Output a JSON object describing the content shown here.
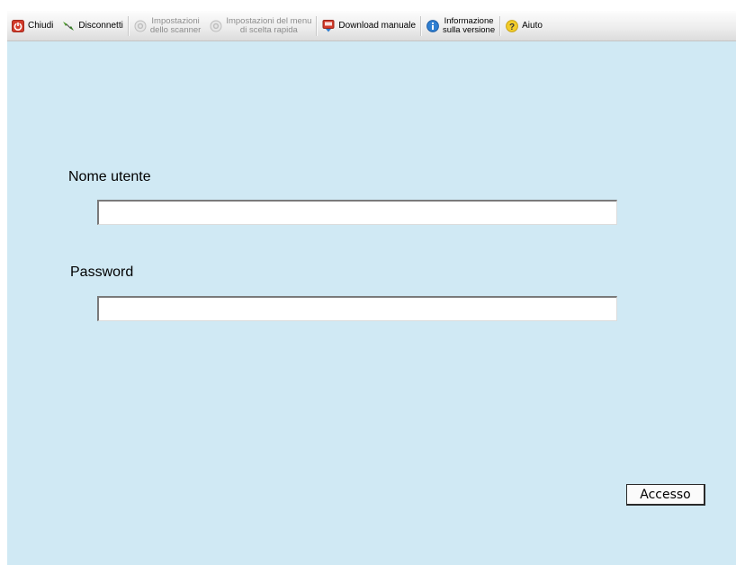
{
  "toolbar": {
    "items": [
      {
        "label": "Chiudi",
        "icon": "power-icon",
        "enabled": true
      },
      {
        "label": "Disconnetti",
        "icon": "disconnect-icon",
        "enabled": true
      },
      {
        "line1": "Impostazioni",
        "line2": "dello scanner",
        "icon": "scanner-settings-icon",
        "enabled": false
      },
      {
        "line1": "Impostazioni del menu",
        "line2": "di scelta rapida",
        "icon": "quick-menu-settings-icon",
        "enabled": false
      },
      {
        "label": "Download manuale",
        "icon": "pdf-download-icon",
        "enabled": true
      },
      {
        "line1": "Informazione",
        "line2": "sulla versione",
        "icon": "info-icon",
        "enabled": true
      },
      {
        "label": "Aiuto",
        "icon": "help-icon",
        "enabled": true
      }
    ]
  },
  "login": {
    "username_label": "Nome utente",
    "username_value": "",
    "password_label": "Password",
    "password_value": "",
    "submit_label": "Accesso"
  },
  "colors": {
    "background": "#d0e9f4",
    "toolbar": "#ececec",
    "power_red": "#d23b2b",
    "info_blue": "#2f7fd1",
    "help_yellow": "#f2cc2a"
  }
}
